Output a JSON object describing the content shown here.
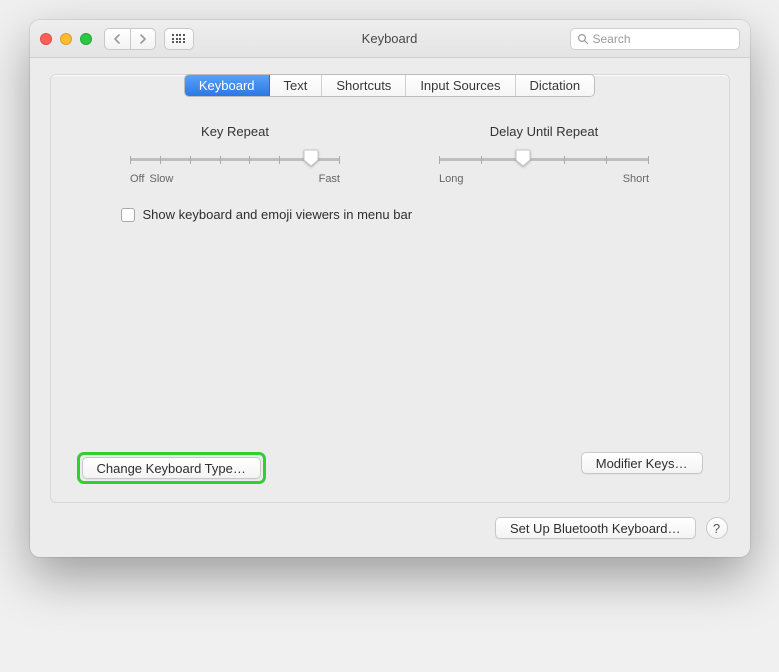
{
  "window": {
    "title": "Keyboard"
  },
  "search": {
    "placeholder": "Search"
  },
  "tabs": [
    {
      "label": "Keyboard",
      "active": true
    },
    {
      "label": "Text",
      "active": false
    },
    {
      "label": "Shortcuts",
      "active": false
    },
    {
      "label": "Input Sources",
      "active": false
    },
    {
      "label": "Dictation",
      "active": false
    }
  ],
  "sliders": {
    "keyRepeat": {
      "title": "Key Repeat",
      "leftOff": "Off",
      "leftSlow": "Slow",
      "right": "Fast",
      "ticks": 8,
      "positionPercent": 86
    },
    "delayUntilRepeat": {
      "title": "Delay Until Repeat",
      "left": "Long",
      "right": "Short",
      "ticks": 6,
      "positionPercent": 40
    }
  },
  "checkbox": {
    "label": "Show keyboard and emoji viewers in menu bar",
    "checked": false
  },
  "buttons": {
    "changeKeyboardType": "Change Keyboard Type…",
    "modifierKeys": "Modifier Keys…",
    "setUpBluetooth": "Set Up Bluetooth Keyboard…",
    "help": "?"
  }
}
